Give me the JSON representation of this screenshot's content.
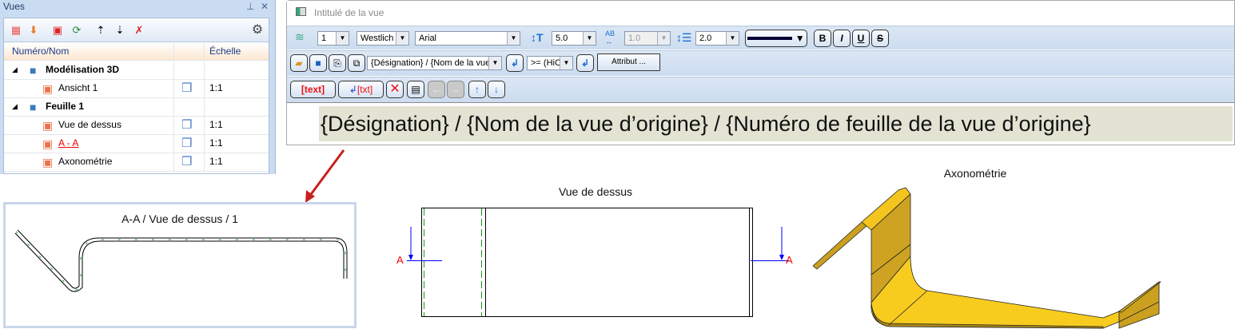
{
  "panel": {
    "title": "Vues",
    "pin_icon": "pin-icon",
    "close_icon": "close-icon",
    "columns": {
      "name": "Numéro/Nom",
      "scale": "Échelle"
    },
    "rows": [
      {
        "label": "Modélisation 3D",
        "level": 0,
        "bold": true,
        "scale": ""
      },
      {
        "label": "Ansicht 1",
        "level": 1,
        "scale": "1:1"
      },
      {
        "label": "Feuille 1",
        "level": 0,
        "bold": true,
        "scale": ""
      },
      {
        "label": "Vue de dessus",
        "level": 1,
        "scale": "1:1"
      },
      {
        "label": "A - A",
        "level": 1,
        "scale": "1:1",
        "active": true
      },
      {
        "label": "Axonométrie",
        "level": 1,
        "scale": "1:1"
      }
    ]
  },
  "dialog": {
    "title": "Intitulé de la vue",
    "layer": "1",
    "line_style": "Westlich",
    "font": "Arial",
    "text_height": "5.0",
    "width_ratio": "1.0",
    "line_spacing": "2.0",
    "bold": "B",
    "italic": "I",
    "underline": "U",
    "strike": "S",
    "template": "{Désignation} / {Nom de la vue d'origine}",
    "operator": ">= (HiCAD)",
    "attribut": "Attribut ...",
    "text_btn": "[text]",
    "txt_btn": "[txt]",
    "content": "{Désignation} / {Nom de la vue d’origine} / {Numéro de feuille de la vue d’origine}"
  },
  "drawing": {
    "detail_title": "A-A / Vue de dessus / 1",
    "top_view_title": "Vue de dessus",
    "axo_title": "Axonométrie",
    "section_label": "A"
  },
  "colors": {
    "accent": "#1e3963",
    "highlight": "#e3e3d3",
    "part": "#f7cc1f"
  }
}
